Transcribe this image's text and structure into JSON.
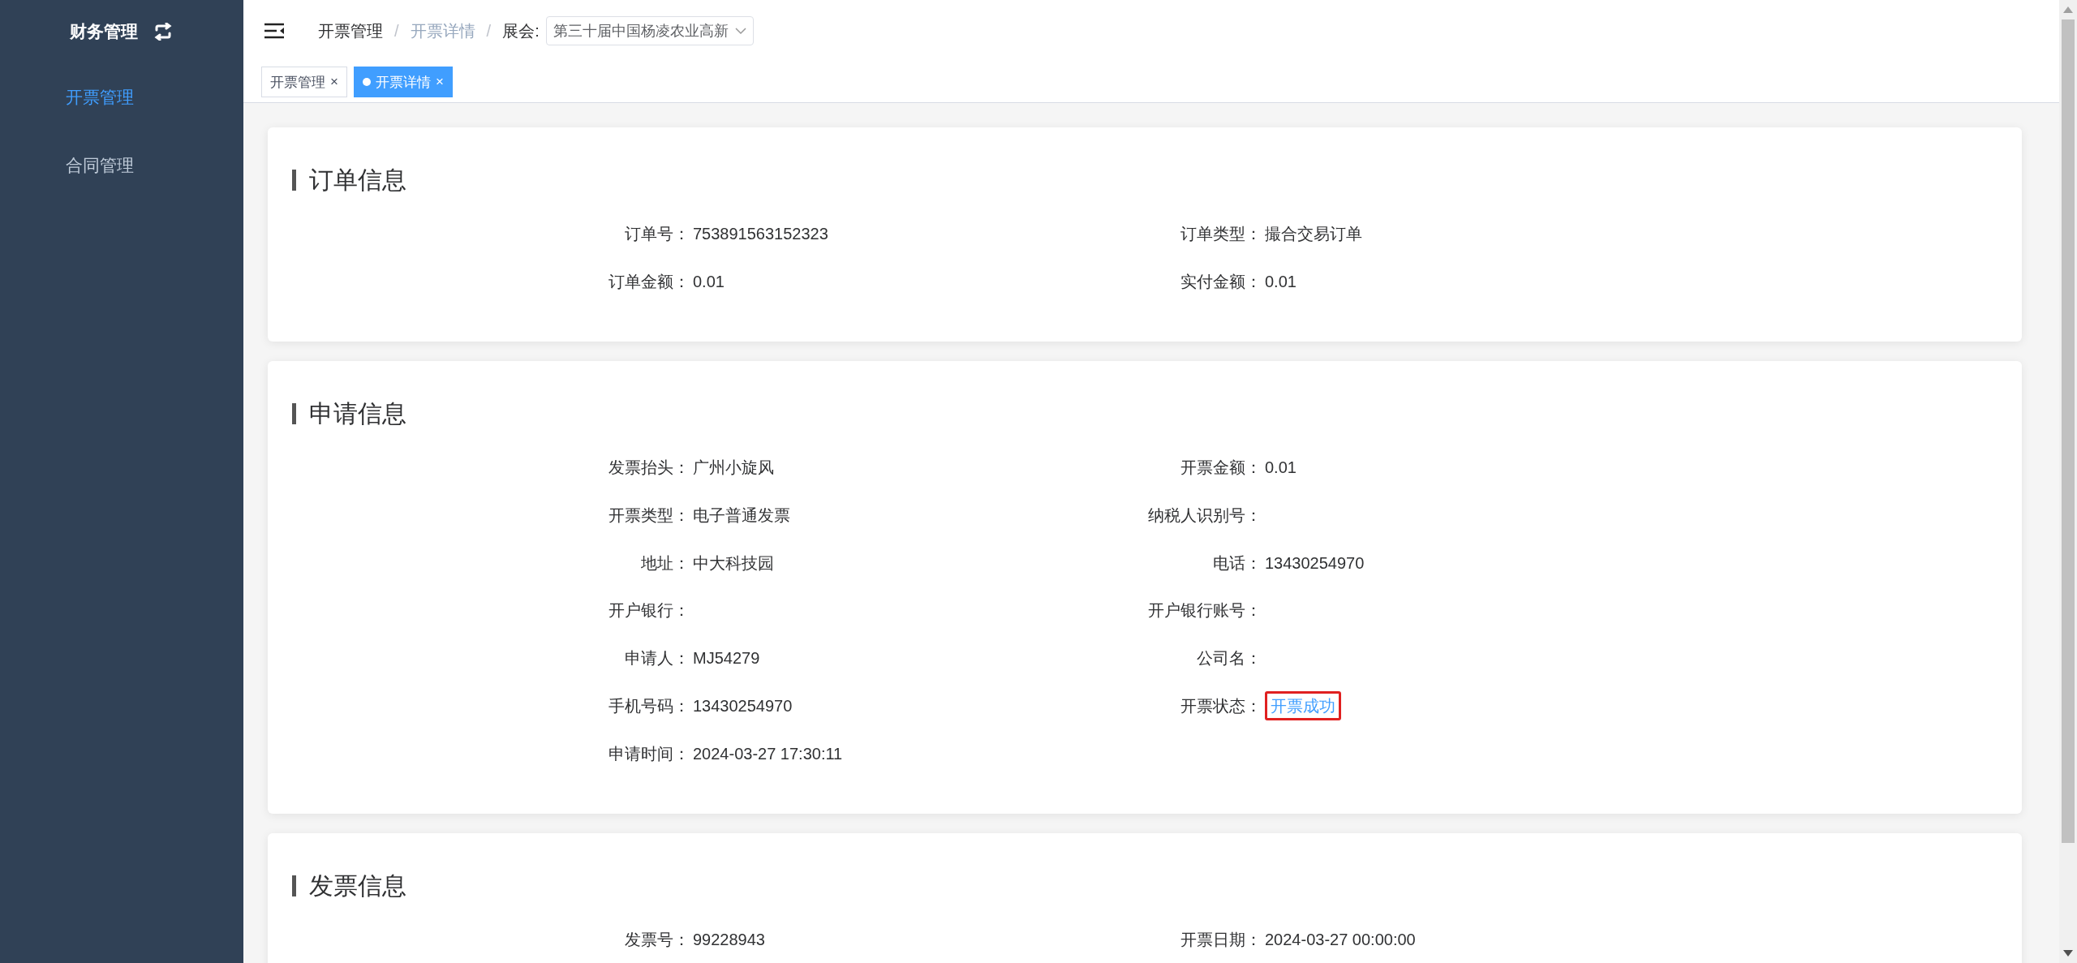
{
  "sidebar": {
    "title": "财务管理",
    "items": [
      {
        "label": "开票管理",
        "selected": true
      },
      {
        "label": "合同管理",
        "selected": false
      }
    ]
  },
  "header": {
    "breadcrumb": [
      {
        "label": "开票管理",
        "current": false
      },
      {
        "label": "开票详情",
        "current": true
      }
    ],
    "separator": "/",
    "expo_label": "展会:",
    "expo_select": {
      "value": "第三十届中国杨凌农业高新"
    }
  },
  "tabs": [
    {
      "label": "开票管理",
      "selected": false,
      "close": "×"
    },
    {
      "label": "开票详情",
      "selected": true,
      "close": "×"
    }
  ],
  "sections": [
    {
      "title": "订单信息",
      "fields": [
        {
          "label": "订单号：",
          "value": "753891563152323"
        },
        {
          "label": "订单类型：",
          "value": "撮合交易订单"
        },
        {
          "label": "订单金额：",
          "value": "0.01"
        },
        {
          "label": "实付金额：",
          "value": "0.01"
        }
      ]
    },
    {
      "title": "申请信息",
      "fields": [
        {
          "label": "发票抬头：",
          "value": "广州小旋风"
        },
        {
          "label": "开票金额：",
          "value": "0.01"
        },
        {
          "label": "开票类型：",
          "value": "电子普通发票"
        },
        {
          "label": "纳税人识别号："
        },
        {
          "label": "地址：",
          "value": "中大科技园"
        },
        {
          "label": "电话：",
          "value": "13430254970"
        },
        {
          "label": "开户银行："
        },
        {
          "label": "开户银行账号："
        },
        {
          "label": "申请人：",
          "value": "MJ54279"
        },
        {
          "label": "公司名："
        },
        {
          "label": "手机号码：",
          "value": "13430254970"
        },
        {
          "label": "开票状态：",
          "value": "开票成功",
          "kind": "status",
          "highlighted": true
        },
        {
          "label": "申请时间：",
          "value": "2024-03-27 17:30:11"
        }
      ]
    },
    {
      "title": "发票信息",
      "fields": [
        {
          "label": "发票号：",
          "value": "99228943"
        },
        {
          "label": "开票日期：",
          "value": "2024-03-27 00:00:00"
        }
      ]
    }
  ]
}
